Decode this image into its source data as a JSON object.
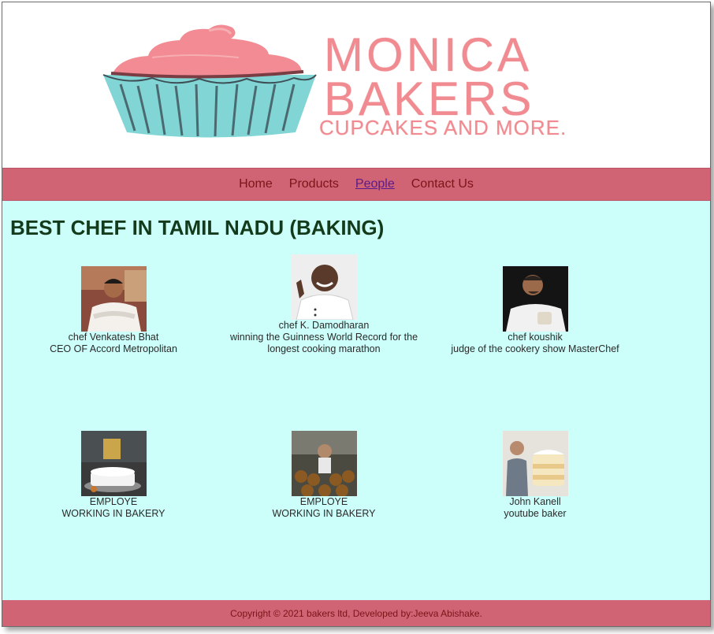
{
  "logo": {
    "line1": "MONICA",
    "line2": "BAKERS",
    "line3": "CUPCAKES AND MORE."
  },
  "nav": {
    "items": [
      {
        "label": "Home",
        "active": false
      },
      {
        "label": "Products",
        "active": false
      },
      {
        "label": "People",
        "active": true
      },
      {
        "label": "Contact Us",
        "active": false
      }
    ]
  },
  "main": {
    "title": "BEST CHEF IN TAMIL NADU (BAKING)",
    "people": [
      {
        "name": "chef Venkatesh Bhat",
        "desc": "CEO OF Accord Metropolitan"
      },
      {
        "name": "chef K. Damodharan",
        "desc": "winning the Guinness World Record for the longest cooking marathon"
      },
      {
        "name": "chef koushik",
        "desc": "judge of the cookery show MasterChef"
      },
      {
        "name": "EMPLOYE",
        "desc": "WORKING IN BAKERY"
      },
      {
        "name": "EMPLOYE",
        "desc": "WORKING IN BAKERY"
      },
      {
        "name": "John Kanell",
        "desc": "youtube baker"
      }
    ]
  },
  "footer": {
    "text": "Copyright © 2021 bakers ltd, Developed by:Jeeva Abishake."
  },
  "colors": {
    "nav_bg": "#d06474",
    "content_bg": "#ccfffa",
    "brand_pink": "#f08b91",
    "cup_teal": "#82d5d5"
  }
}
